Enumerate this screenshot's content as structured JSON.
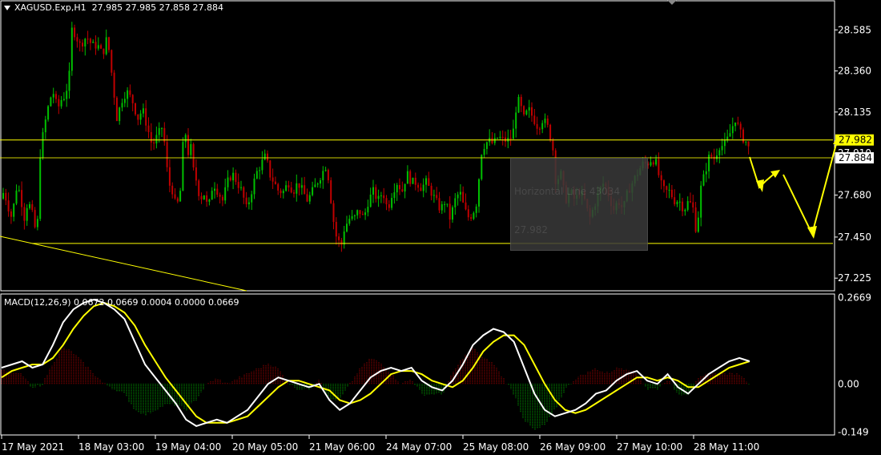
{
  "header": {
    "symbol_line": "XAGUSD.Exp,H1  27.985 27.985 27.858 27.884",
    "macd_line": "MACD(12,26,9) 0.0672 0.0669 0.0004 0.0000 0.0669"
  },
  "tooltip": {
    "name": "Horizontal Line 43034",
    "value": "27.982"
  },
  "colors": {
    "background": "#000000",
    "bull": "#00c000",
    "bear": "#c00000",
    "trendline": "#ffff00",
    "macd_line": "#ffffff",
    "signal_line": "#ffff00",
    "label_yellow_bg": "#ffff00",
    "label_white_bg": "#ffffff",
    "axis_text": "#ffffff",
    "frame": "#ffffff"
  },
  "chart_data": [
    {
      "type": "candlestick",
      "title": "XAGUSD.Exp,H1",
      "x_tick_labels": [
        "17 May 2021",
        "18 May 03:00",
        "19 May 04:00",
        "20 May 05:00",
        "21 May 06:00",
        "24 May 07:00",
        "25 May 08:00",
        "26 May 09:00",
        "27 May 10:00",
        "28 May 11:00"
      ],
      "y_tick_labels": [
        "28.585",
        "28.360",
        "28.135",
        "27.910",
        "27.680",
        "27.450",
        "27.225"
      ],
      "ylim": [
        27.16,
        28.74
      ],
      "price_labels": [
        {
          "text": "27.982",
          "value": 27.982,
          "style": "yellow"
        },
        {
          "text": "27.884",
          "value": 27.884,
          "style": "white"
        }
      ],
      "horizontal_lines": [
        27.982,
        27.884,
        27.415
      ],
      "close_path_anchors": [
        [
          0,
          27.66
        ],
        [
          5,
          27.7
        ],
        [
          10,
          27.62
        ],
        [
          15,
          27.55
        ],
        [
          20,
          27.72
        ],
        [
          25,
          27.7
        ],
        [
          30,
          27.55
        ],
        [
          35,
          27.65
        ],
        [
          42,
          27.55
        ],
        [
          46,
          27.43
        ],
        [
          50,
          27.9
        ],
        [
          55,
          28.05
        ],
        [
          62,
          28.2
        ],
        [
          66,
          28.25
        ],
        [
          72,
          28.15
        ],
        [
          76,
          28.2
        ],
        [
          80,
          28.22
        ],
        [
          86,
          28.3
        ],
        [
          90,
          28.6
        ],
        [
          95,
          28.55
        ],
        [
          100,
          28.5
        ],
        [
          108,
          28.55
        ],
        [
          115,
          28.5
        ],
        [
          122,
          28.5
        ],
        [
          128,
          28.45
        ],
        [
          134,
          28.55
        ],
        [
          138,
          28.4
        ],
        [
          142,
          28.25
        ],
        [
          146,
          28.1
        ],
        [
          152,
          28.2
        ],
        [
          158,
          28.25
        ],
        [
          165,
          28.2
        ],
        [
          172,
          28.1
        ],
        [
          178,
          28.15
        ],
        [
          184,
          28.05
        ],
        [
          190,
          27.95
        ],
        [
          196,
          28.0
        ],
        [
          202,
          28.05
        ],
        [
          206,
          27.95
        ],
        [
          210,
          27.75
        ],
        [
          216,
          27.7
        ],
        [
          220,
          27.6
        ],
        [
          226,
          27.72
        ],
        [
          230,
          28.1
        ],
        [
          234,
          27.9
        ],
        [
          238,
          27.95
        ],
        [
          242,
          27.8
        ],
        [
          246,
          27.75
        ],
        [
          250,
          27.65
        ],
        [
          254,
          27.7
        ],
        [
          260,
          27.6
        ],
        [
          266,
          27.75
        ],
        [
          272,
          27.7
        ],
        [
          278,
          27.65
        ],
        [
          284,
          27.75
        ],
        [
          290,
          27.8
        ],
        [
          296,
          27.75
        ],
        [
          302,
          27.7
        ],
        [
          308,
          27.6
        ],
        [
          314,
          27.7
        ],
        [
          320,
          27.8
        ],
        [
          326,
          27.85
        ],
        [
          332,
          27.9
        ],
        [
          336,
          27.8
        ],
        [
          342,
          27.75
        ],
        [
          348,
          27.7
        ],
        [
          354,
          27.7
        ],
        [
          360,
          27.75
        ],
        [
          366,
          27.7
        ],
        [
          372,
          27.75
        ],
        [
          378,
          27.7
        ],
        [
          384,
          27.65
        ],
        [
          390,
          27.7
        ],
        [
          396,
          27.75
        ],
        [
          402,
          27.8
        ],
        [
          408,
          27.85
        ],
        [
          412,
          27.7
        ],
        [
          416,
          27.55
        ],
        [
          420,
          27.45
        ],
        [
          426,
          27.4
        ],
        [
          430,
          27.5
        ],
        [
          436,
          27.55
        ],
        [
          442,
          27.55
        ],
        [
          448,
          27.6
        ],
        [
          454,
          27.55
        ],
        [
          460,
          27.65
        ],
        [
          466,
          27.7
        ],
        [
          472,
          27.65
        ],
        [
          478,
          27.7
        ],
        [
          484,
          27.6
        ],
        [
          490,
          27.7
        ],
        [
          496,
          27.75
        ],
        [
          502,
          27.7
        ],
        [
          508,
          27.8
        ],
        [
          514,
          27.75
        ],
        [
          520,
          27.75
        ],
        [
          526,
          27.72
        ],
        [
          532,
          27.75
        ],
        [
          538,
          27.7
        ],
        [
          544,
          27.65
        ],
        [
          550,
          27.6
        ],
        [
          556,
          27.65
        ],
        [
          562,
          27.55
        ],
        [
          568,
          27.65
        ],
        [
          574,
          27.7
        ],
        [
          580,
          27.6
        ],
        [
          586,
          27.55
        ],
        [
          592,
          27.6
        ],
        [
          596,
          27.65
        ],
        [
          600,
          27.9
        ],
        [
          604,
          27.95
        ],
        [
          610,
          27.98
        ],
        [
          616,
          27.96
        ],
        [
          622,
          28.0
        ],
        [
          628,
          27.98
        ],
        [
          634,
          27.98
        ],
        [
          640,
          28.0
        ],
        [
          644,
          28.15
        ],
        [
          648,
          28.2
        ],
        [
          654,
          28.1
        ],
        [
          660,
          28.15
        ],
        [
          666,
          28.1
        ],
        [
          672,
          28.05
        ],
        [
          678,
          28.1
        ],
        [
          684,
          28.05
        ],
        [
          690,
          27.95
        ],
        [
          694,
          27.75
        ],
        [
          700,
          27.8
        ],
        [
          706,
          27.65
        ],
        [
          712,
          27.7
        ],
        [
          718,
          27.65
        ],
        [
          724,
          27.7
        ],
        [
          730,
          27.65
        ],
        [
          736,
          27.55
        ],
        [
          742,
          27.62
        ],
        [
          748,
          27.7
        ],
        [
          754,
          27.75
        ],
        [
          760,
          27.68
        ],
        [
          766,
          27.6
        ],
        [
          772,
          27.65
        ],
        [
          778,
          27.6
        ],
        [
          784,
          27.7
        ],
        [
          790,
          27.75
        ],
        [
          796,
          27.8
        ],
        [
          802,
          27.85
        ],
        [
          808,
          27.85
        ],
        [
          814,
          27.88
        ],
        [
          820,
          27.85
        ],
        [
          824,
          27.75
        ],
        [
          830,
          27.7
        ],
        [
          836,
          27.7
        ],
        [
          842,
          27.65
        ],
        [
          848,
          27.65
        ],
        [
          854,
          27.6
        ],
        [
          860,
          27.65
        ],
        [
          866,
          27.6
        ],
        [
          870,
          27.45
        ],
        [
          874,
          27.7
        ],
        [
          880,
          27.8
        ],
        [
          886,
          27.9
        ],
        [
          892,
          27.88
        ],
        [
          898,
          27.95
        ],
        [
          904,
          27.95
        ],
        [
          910,
          28.0
        ],
        [
          914,
          28.05
        ],
        [
          918,
          28.1
        ],
        [
          922,
          28.05
        ],
        [
          926,
          28.0
        ],
        [
          930,
          27.98
        ],
        [
          934,
          27.96
        ],
        [
          936,
          27.884
        ]
      ],
      "annotations": [
        "trendline",
        "yellow projection arrows"
      ]
    },
    {
      "type": "macd",
      "title": "MACD(12,26,9)",
      "y_tick_labels": [
        "0.2669",
        "0.00",
        "-0.149"
      ],
      "ylim": [
        -0.155,
        0.275
      ],
      "macd_values": [
        0.05,
        0.06,
        0.07,
        0.05,
        0.06,
        0.12,
        0.19,
        0.23,
        0.25,
        0.26,
        0.25,
        0.23,
        0.2,
        0.13,
        0.06,
        0.02,
        -0.02,
        -0.06,
        -0.11,
        -0.13,
        -0.12,
        -0.11,
        -0.12,
        -0.1,
        -0.08,
        -0.04,
        0.0,
        0.02,
        0.01,
        0.0,
        -0.01,
        0.0,
        -0.05,
        -0.08,
        -0.06,
        -0.02,
        0.02,
        0.04,
        0.05,
        0.04,
        0.05,
        0.01,
        -0.01,
        -0.02,
        0.01,
        0.06,
        0.12,
        0.15,
        0.17,
        0.16,
        0.13,
        0.05,
        -0.03,
        -0.08,
        -0.1,
        -0.09,
        -0.08,
        -0.06,
        -0.03,
        -0.02,
        0.01,
        0.03,
        0.04,
        0.01,
        0.0,
        0.03,
        -0.01,
        -0.03,
        0.0,
        0.03,
        0.05,
        0.07,
        0.08,
        0.07
      ],
      "signal_values": [
        0.02,
        0.04,
        0.05,
        0.06,
        0.06,
        0.08,
        0.12,
        0.17,
        0.21,
        0.24,
        0.25,
        0.24,
        0.22,
        0.18,
        0.12,
        0.07,
        0.02,
        -0.02,
        -0.06,
        -0.1,
        -0.12,
        -0.12,
        -0.12,
        -0.11,
        -0.1,
        -0.07,
        -0.04,
        -0.01,
        0.01,
        0.01,
        0.0,
        -0.01,
        -0.02,
        -0.05,
        -0.06,
        -0.05,
        -0.03,
        0.0,
        0.03,
        0.04,
        0.04,
        0.03,
        0.01,
        0.0,
        -0.01,
        0.01,
        0.05,
        0.1,
        0.13,
        0.15,
        0.15,
        0.12,
        0.06,
        0.0,
        -0.05,
        -0.08,
        -0.09,
        -0.08,
        -0.06,
        -0.04,
        -0.02,
        0.0,
        0.02,
        0.02,
        0.01,
        0.02,
        0.01,
        -0.01,
        -0.01,
        0.01,
        0.03,
        0.05,
        0.06,
        0.07
      ]
    }
  ]
}
